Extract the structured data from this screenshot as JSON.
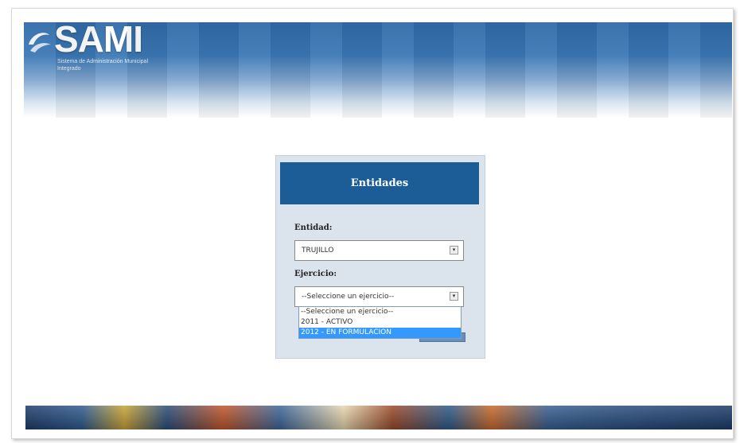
{
  "header": {
    "logo_text": "SAMI",
    "logo_subtitle": "Sistema de Administración Municipal Integrado"
  },
  "panel": {
    "title": "Entidades",
    "entidad_label": "Entidad:",
    "entidad_value": "TRUJILLO",
    "ejercicio_label": "Ejercicio:",
    "ejercicio_value": "--Seleccione un ejercicio--",
    "dropdown_options": [
      {
        "label": "--Seleccione un ejercicio--",
        "selected": false
      },
      {
        "label": "2011 - ACTIVO",
        "selected": false
      },
      {
        "label": "2012 - EN FORMULACION",
        "selected": true
      }
    ]
  },
  "colors": {
    "panel_header": "#1c5d98",
    "panel_bg": "#dbe3ec",
    "highlight": "#3399ff"
  }
}
